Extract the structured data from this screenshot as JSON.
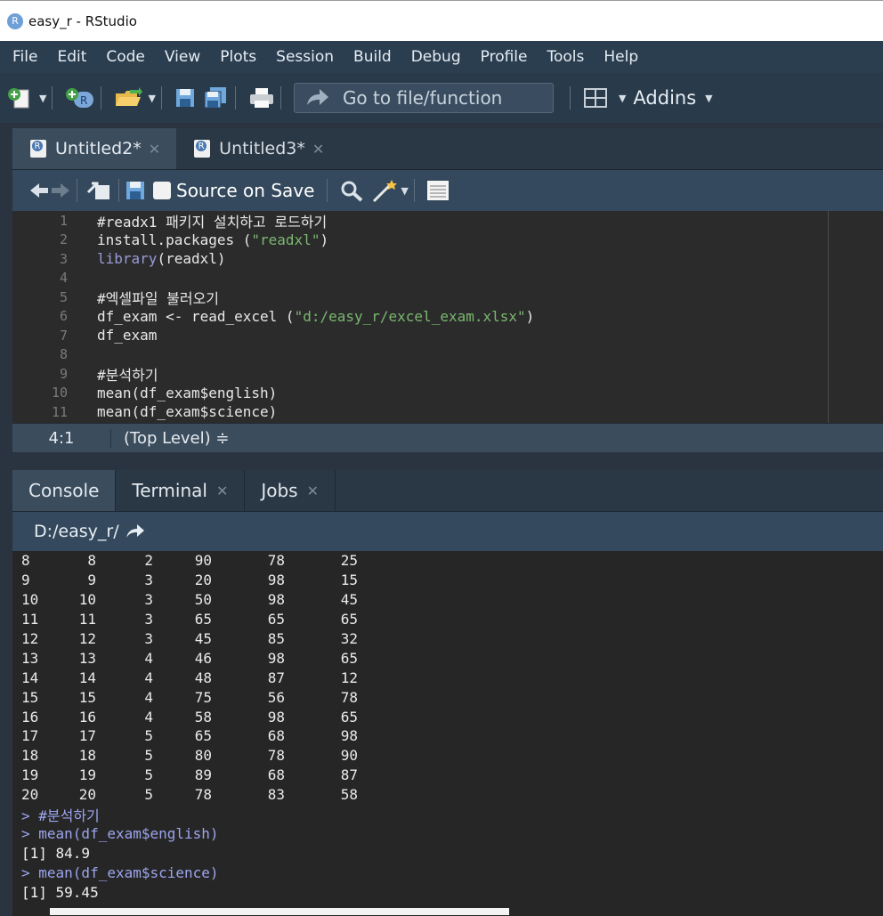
{
  "window": {
    "title": "easy_r - RStudio",
    "logo_letter": "R"
  },
  "menu": [
    "File",
    "Edit",
    "Code",
    "View",
    "Plots",
    "Session",
    "Build",
    "Debug",
    "Profile",
    "Tools",
    "Help"
  ],
  "toolbar": {
    "goto_label": "Go to file/function",
    "addins_label": "Addins"
  },
  "editor": {
    "tabs": [
      {
        "label": "Untitled2*",
        "active": true
      },
      {
        "label": "Untitled3*",
        "active": false
      }
    ],
    "source_on_save": "Source on Save",
    "lines": [
      {
        "n": "1",
        "text": "#readx1 패키지 설치하고 로드하기",
        "kind": "comment"
      },
      {
        "n": "2",
        "text": "install.packages (\"readxl\")",
        "kind": "install"
      },
      {
        "n": "3",
        "text": "library(readxl)",
        "kind": "library"
      },
      {
        "n": "4",
        "text": "",
        "kind": "plain"
      },
      {
        "n": "5",
        "text": "#엑셀파일 불러오기",
        "kind": "comment"
      },
      {
        "n": "6",
        "text": "df_exam <- read_excel (\"d:/easy_r/excel_exam.xlsx\")",
        "kind": "read"
      },
      {
        "n": "7",
        "text": "df_exam",
        "kind": "plain"
      },
      {
        "n": "8",
        "text": "",
        "kind": "plain"
      },
      {
        "n": "9",
        "text": "#분석하기",
        "kind": "comment"
      },
      {
        "n": "10",
        "text": "mean(df_exam$english)",
        "kind": "plain"
      },
      {
        "n": "11",
        "text": "mean(df_exam$science)",
        "kind": "plain"
      }
    ],
    "status_position": "4:1",
    "status_scope": "(Top Level) ≑"
  },
  "console": {
    "tabs": [
      "Console",
      "Terminal",
      "Jobs"
    ],
    "path": "D:/easy_r/",
    "rows": [
      [
        "8",
        "8",
        "2",
        "90",
        "78",
        "25"
      ],
      [
        "9",
        "9",
        "3",
        "20",
        "98",
        "15"
      ],
      [
        "10",
        "10",
        "3",
        "50",
        "98",
        "45"
      ],
      [
        "11",
        "11",
        "3",
        "65",
        "65",
        "65"
      ],
      [
        "12",
        "12",
        "3",
        "45",
        "85",
        "32"
      ],
      [
        "13",
        "13",
        "4",
        "46",
        "98",
        "65"
      ],
      [
        "14",
        "14",
        "4",
        "48",
        "87",
        "12"
      ],
      [
        "15",
        "15",
        "4",
        "75",
        "56",
        "78"
      ],
      [
        "16",
        "16",
        "4",
        "58",
        "98",
        "65"
      ],
      [
        "17",
        "17",
        "5",
        "65",
        "68",
        "98"
      ],
      [
        "18",
        "18",
        "5",
        "80",
        "78",
        "90"
      ],
      [
        "19",
        "19",
        "5",
        "89",
        "68",
        "87"
      ],
      [
        "20",
        "20",
        "5",
        "78",
        "83",
        "58"
      ]
    ],
    "after": [
      {
        "type": "prompt",
        "text": "> #분석하기"
      },
      {
        "type": "prompt",
        "text": "> mean(df_exam$english)"
      },
      {
        "type": "result",
        "text": "[1] 84.9"
      },
      {
        "type": "prompt",
        "text": "> mean(df_exam$science)"
      },
      {
        "type": "result",
        "text": "[1] 59.45"
      }
    ]
  }
}
